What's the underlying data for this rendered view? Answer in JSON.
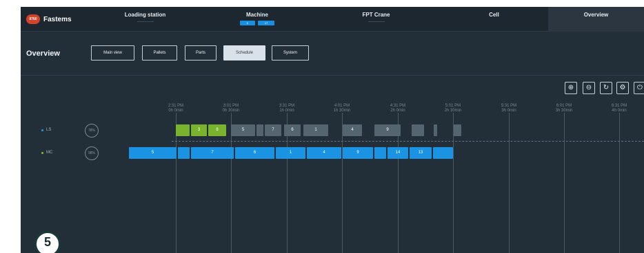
{
  "brand": {
    "badge": "8760",
    "name": "Fastems"
  },
  "nav": {
    "tabs": [
      {
        "label": "Loading station"
      },
      {
        "label": "Machine",
        "chips": [
          "5",
          "17"
        ]
      },
      {
        "label": "FPT Crane"
      },
      {
        "label": "Cell"
      },
      {
        "label": "Overview"
      }
    ]
  },
  "page": {
    "title": "Overview"
  },
  "views": [
    "Main view",
    "Pallets",
    "Parts",
    "Schedule",
    "System"
  ],
  "toolbar_icons": [
    "zoom-in-icon",
    "zoom-out-icon",
    "refresh-icon",
    "settings-icon",
    "power-icon"
  ],
  "timeline": {
    "ticks": [
      {
        "time": "2:31 PM",
        "offset": "0h 0min"
      },
      {
        "time": "3:01 PM",
        "offset": "0h 30min"
      },
      {
        "time": "3:31 PM",
        "offset": "1h 0min"
      },
      {
        "time": "4:01 PM",
        "offset": "1h 30min"
      },
      {
        "time": "4:31 PM",
        "offset": "2h 0min"
      },
      {
        "time": "5:01 PM",
        "offset": "2h 30min"
      },
      {
        "time": "5:31 PM",
        "offset": "3h 0min"
      },
      {
        "time": "6:01 PM",
        "offset": "3h 30min"
      },
      {
        "time": "6:31 PM",
        "offset": "4h 0min"
      }
    ],
    "rows": [
      {
        "name": "LS",
        "utilization": "78%",
        "dot_color": "#1a93e2"
      },
      {
        "name": "MC",
        "utilization": "98%",
        "dot_color": "#7ab32e"
      }
    ],
    "ls_blocks": [
      "",
      "3",
      "8",
      "5",
      "",
      "7",
      "6",
      "1",
      "4",
      "9",
      "",
      "",
      ""
    ],
    "mc_blocks": [
      "5",
      "",
      "7",
      "6",
      "1",
      "4",
      "9",
      "",
      "14",
      "13",
      ""
    ]
  },
  "step_marker": "5",
  "colors": {
    "accent": "#1a93e2",
    "green": "#7ab32e",
    "gray_block": "#556570",
    "logo": "#d8412a"
  }
}
